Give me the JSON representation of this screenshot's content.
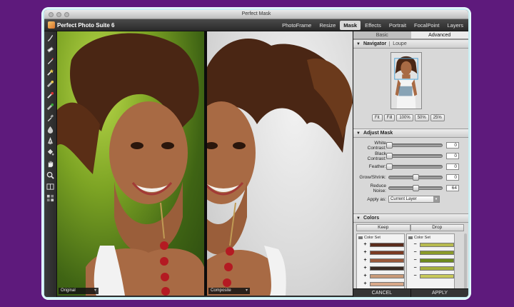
{
  "window": {
    "title": "Perfect Mask"
  },
  "app": {
    "name": "Perfect Photo Suite 6"
  },
  "nav": {
    "items": [
      {
        "label": "PhotoFrame",
        "active": false
      },
      {
        "label": "Resize",
        "active": false
      },
      {
        "label": "Mask",
        "active": true
      },
      {
        "label": "Effects",
        "active": false
      },
      {
        "label": "Portrait",
        "active": false
      },
      {
        "label": "FocalPoint",
        "active": false
      },
      {
        "label": "Layers",
        "active": false
      }
    ]
  },
  "tools": [
    "brush-icon",
    "eraser-icon",
    "pen-icon",
    "magic-brush-icon",
    "magic-eraser-icon",
    "drop-brush-icon",
    "drop-eraser-icon",
    "eyedropper-icon",
    "fill-icon",
    "blend-icon",
    "bucket-icon",
    "hand-icon",
    "zoom-icon",
    "compare-icon",
    "view-mode-icon"
  ],
  "canvas": {
    "left_label": "Original",
    "right_label": "Composite"
  },
  "panel": {
    "tabs": [
      {
        "label": "Basic",
        "active": false
      },
      {
        "label": "Advanced",
        "active": true
      }
    ],
    "navigator": {
      "title": "Navigator",
      "alt_title": "Loupe",
      "zoom_buttons": [
        "Fit",
        "Fill",
        "100%",
        "50%",
        "25%"
      ]
    },
    "adjust": {
      "title": "Adjust Mask",
      "sliders": [
        {
          "label": "White Contrast:",
          "value": "0",
          "level": 0.0
        },
        {
          "label": "Black Contrast:",
          "value": "0",
          "level": 0.0
        },
        {
          "label": "Feather:",
          "value": "0",
          "level": 0.0
        },
        {
          "label": "Grow/Shrink:",
          "value": "0",
          "level": 0.5
        },
        {
          "label": "Reduce Noise:",
          "value": "64",
          "level": 0.5
        }
      ],
      "apply_label": "Apply as:",
      "apply_value": "Current Layer"
    },
    "colors": {
      "title": "Colors",
      "keep_label": "Keep",
      "drop_label": "Drop",
      "set_label": "Color Set",
      "keep_swatches": [
        "#5a2c1c",
        "#7a3a22",
        "#9a5a3c",
        "#3a2a22",
        "#c89a78",
        "#d8a888"
      ],
      "drop_swatches": [
        "#b7ba4e",
        "#8a9a2a",
        "#6e8a1e",
        "#a6b03c",
        "#c8c85a"
      ]
    }
  },
  "actions": {
    "cancel": "CANCEL",
    "apply": "APPLY"
  }
}
